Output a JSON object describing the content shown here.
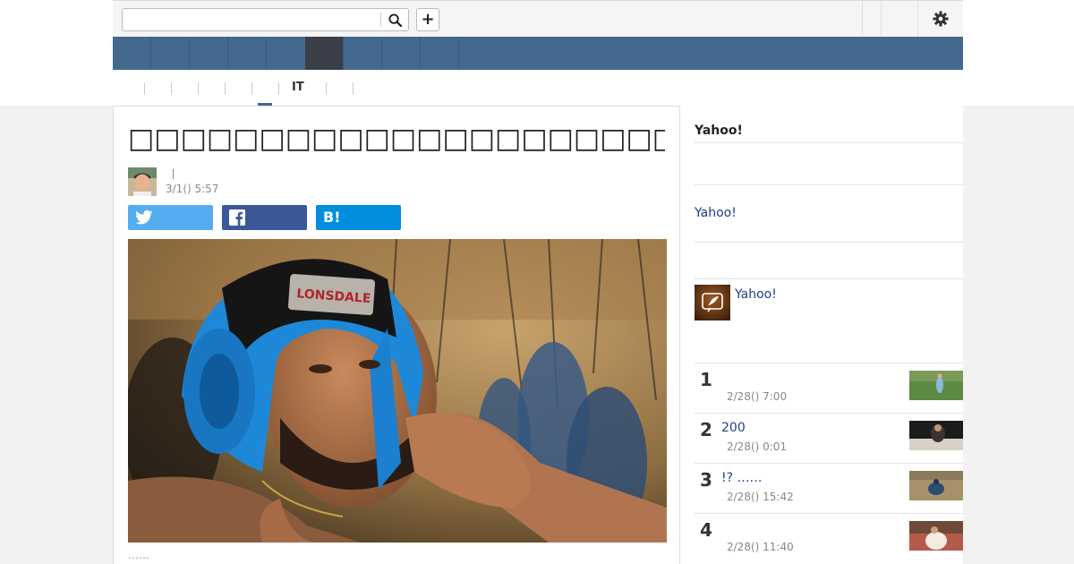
{
  "header": {
    "search": {
      "placeholder": "",
      "value": ""
    },
    "search_icon": "search-icon",
    "plus_label": "+",
    "settings_icon": "gear-icon"
  },
  "nav": {
    "tabs": [
      {
        "label": ""
      },
      {
        "label": ""
      },
      {
        "label": ""
      },
      {
        "label": ""
      },
      {
        "label": "",
        "active": true
      },
      {
        "label": ""
      },
      {
        "label": ""
      },
      {
        "label": ""
      }
    ]
  },
  "subnav": {
    "active_label": "IT"
  },
  "article": {
    "title": "□□□□□□□□□□□□□□□□□□□□□□□□□□□□□□",
    "author_separator": "|",
    "date": "3/1() 5:57",
    "lead": "……",
    "share": {
      "twitter": "twitter-icon",
      "facebook": "facebook-icon",
      "hatena": "B!"
    }
  },
  "sidebar": {
    "heading": "Yahoo!",
    "link1": "Yahoo!",
    "link2": "Yahoo!",
    "ranking": [
      {
        "rank": "1",
        "title": "",
        "date": "2/28() 7:00"
      },
      {
        "rank": "2",
        "title": "200",
        "date": "2/28() 0:01"
      },
      {
        "rank": "3",
        "title": "!? ……",
        "date": "2/28() 15:42"
      },
      {
        "rank": "4",
        "title": "",
        "date": "2/28() 11:40"
      }
    ]
  },
  "colors": {
    "nav": "#44698f",
    "nav_active": "#3b3f4a",
    "twitter": "#55acee",
    "facebook": "#3b5998",
    "hatena": "#008fde",
    "link": "#1a3f8a"
  }
}
